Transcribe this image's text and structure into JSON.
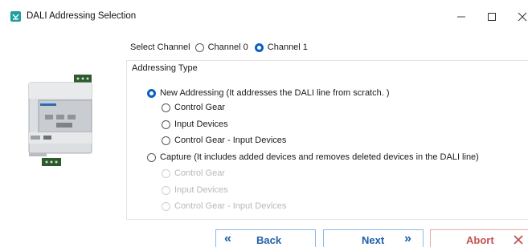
{
  "window": {
    "title": "DALI Addressing Selection",
    "minimize_icon": "minimize-icon",
    "maximize_icon": "maximize-icon",
    "close_icon": "close-icon"
  },
  "channel": {
    "label": "Select Channel",
    "options": [
      {
        "label": "Channel 0",
        "selected": false
      },
      {
        "label": "Channel 1",
        "selected": true
      }
    ]
  },
  "addressing": {
    "group_title": "Addressing Type",
    "new": {
      "label": "New Addressing (It addresses the DALI line from scratch. )",
      "selected": true,
      "suboptions": [
        "Control Gear",
        "Input Devices",
        "Control Gear -  Input Devices"
      ]
    },
    "capture": {
      "label": "Capture (It includes added devices and  removes deleted devices in the DALI line)",
      "selected": false,
      "suboptions": [
        "Control Gear",
        "Input Devices",
        "Control Gear -  Input Devices"
      ]
    }
  },
  "buttons": {
    "back": {
      "label": "Back",
      "icon": "double-chevron-left-icon"
    },
    "next": {
      "label": "Next",
      "icon": "double-chevron-right-icon"
    },
    "abort": {
      "label": "Abort",
      "icon": "close-icon"
    }
  },
  "colors": {
    "accent": "#0a5fc4",
    "button_text": "#1f5fa8",
    "abort_text": "#c95050",
    "app_icon": "#1f9e9e"
  }
}
